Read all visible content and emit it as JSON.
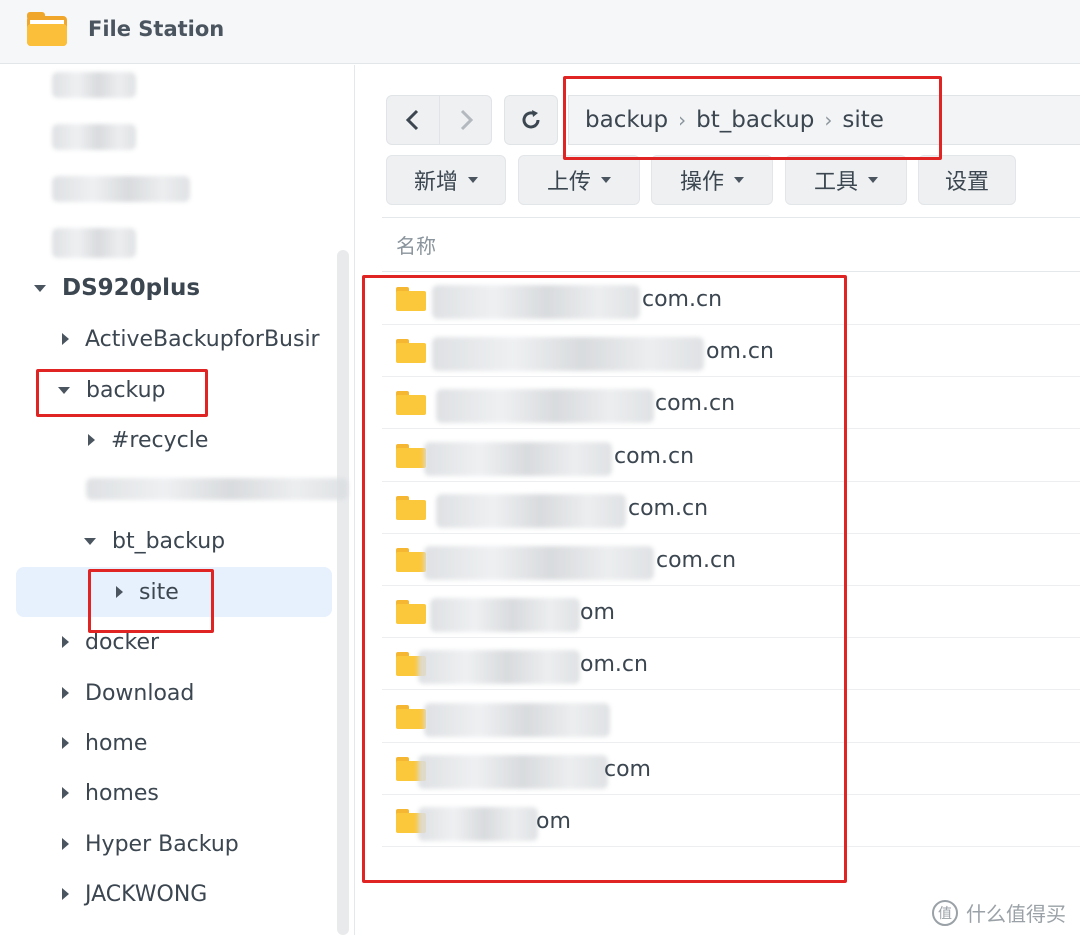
{
  "window": {
    "title": "File Station"
  },
  "sidebar": {
    "root": "DS920plus",
    "items": [
      {
        "label": "ActiveBackupforBusir"
      },
      {
        "label": "backup"
      },
      {
        "label": "#recycle"
      },
      {
        "label": "bt_backup"
      },
      {
        "label": "site"
      },
      {
        "label": "docker"
      },
      {
        "label": "Download"
      },
      {
        "label": "home"
      },
      {
        "label": "homes"
      },
      {
        "label": "Hyper Backup"
      },
      {
        "label": "JACKWONG"
      }
    ]
  },
  "breadcrumb": {
    "parts": [
      "backup",
      "bt_backup",
      "site"
    ]
  },
  "toolbar": {
    "buttons": [
      {
        "label": "新增"
      },
      {
        "label": "上传"
      },
      {
        "label": "操作"
      },
      {
        "label": "工具"
      },
      {
        "label": "设置"
      }
    ]
  },
  "file_list": {
    "column_name": "名称",
    "rows": [
      {
        "name_suffix": "com.cn"
      },
      {
        "name_suffix": "om.cn"
      },
      {
        "name_suffix": "com.cn"
      },
      {
        "name_suffix": "com.cn"
      },
      {
        "name_suffix": "com.cn"
      },
      {
        "name_suffix": "com.cn"
      },
      {
        "name_suffix": "om"
      },
      {
        "name_suffix": "om.cn"
      },
      {
        "name_suffix": ""
      },
      {
        "name_suffix": "com"
      },
      {
        "name_suffix": "om"
      }
    ]
  },
  "watermark": {
    "text": "什么值得买",
    "icon": "值"
  },
  "colors": {
    "accent_selected": "#e6f1fd",
    "annotation": "#e02424",
    "folder": "#fbc73b"
  }
}
